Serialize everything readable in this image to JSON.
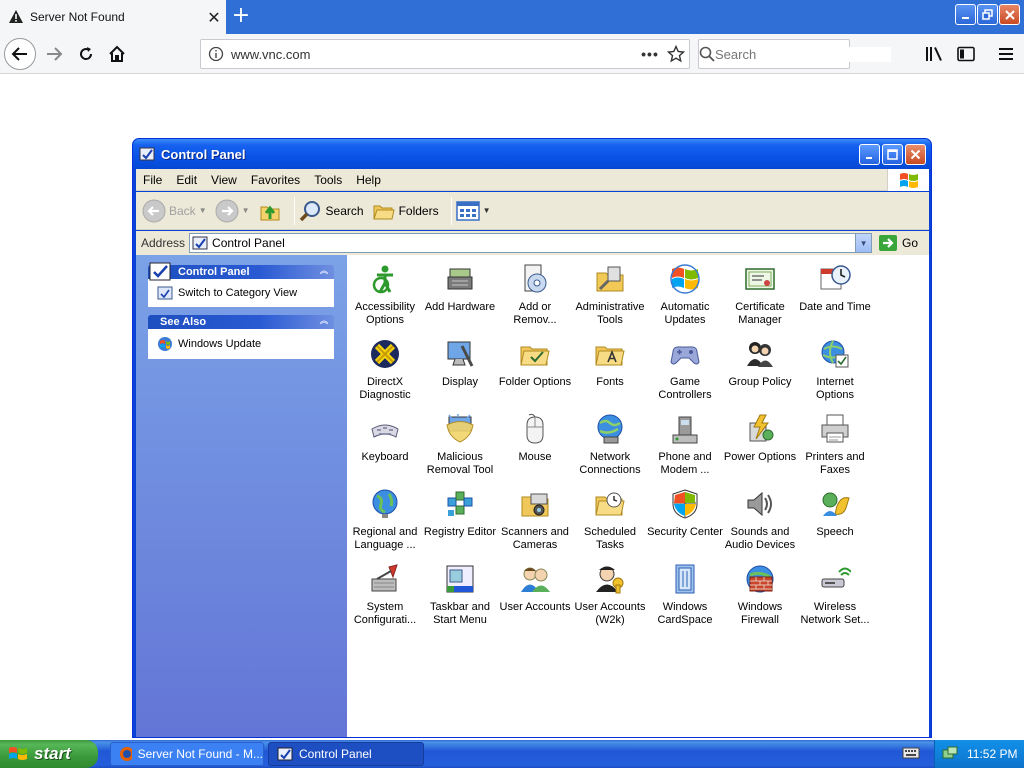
{
  "browser": {
    "tab_title": "Server Not Found",
    "url": "www.vnc.com",
    "search_placeholder": "Search",
    "page_actions": "•••"
  },
  "window": {
    "title": "Control Panel",
    "menu": [
      "File",
      "Edit",
      "View",
      "Favorites",
      "Tools",
      "Help"
    ],
    "toolbar": {
      "back": "Back",
      "search": "Search",
      "folders": "Folders"
    },
    "address": {
      "label": "Address",
      "value": "Control Panel",
      "go": "Go"
    }
  },
  "sidebar": {
    "control_panel_head": "Control Panel",
    "switch_view": "Switch to Category View",
    "see_also_head": "See Also",
    "windows_update": "Windows Update"
  },
  "items": [
    {
      "label": "Accessibility Options",
      "icon": "accessibility-icon"
    },
    {
      "label": "Add Hardware",
      "icon": "add-hardware-icon"
    },
    {
      "label": "Add or Remov...",
      "icon": "add-remove-icon"
    },
    {
      "label": "Administrative Tools",
      "icon": "admin-tools-icon"
    },
    {
      "label": "Automatic Updates",
      "icon": "automatic-updates-icon"
    },
    {
      "label": "Certificate Manager",
      "icon": "certificate-icon"
    },
    {
      "label": "Date and Time",
      "icon": "date-time-icon"
    },
    {
      "label": "DirectX Diagnostic",
      "icon": "directx-icon"
    },
    {
      "label": "Display",
      "icon": "display-icon"
    },
    {
      "label": "Folder Options",
      "icon": "folder-options-icon"
    },
    {
      "label": "Fonts",
      "icon": "fonts-icon"
    },
    {
      "label": "Game Controllers",
      "icon": "game-controller-icon"
    },
    {
      "label": "Group Policy",
      "icon": "group-policy-icon"
    },
    {
      "label": "Internet Options",
      "icon": "internet-options-icon"
    },
    {
      "label": "Keyboard",
      "icon": "keyboard-icon"
    },
    {
      "label": "Malicious Removal Tool",
      "icon": "malicious-removal-icon"
    },
    {
      "label": "Mouse",
      "icon": "mouse-icon"
    },
    {
      "label": "Network Connections",
      "icon": "network-icon"
    },
    {
      "label": "Phone and Modem ...",
      "icon": "phone-modem-icon"
    },
    {
      "label": "Power Options",
      "icon": "power-icon"
    },
    {
      "label": "Printers and Faxes",
      "icon": "printer-icon"
    },
    {
      "label": "Regional and Language ...",
      "icon": "regional-icon"
    },
    {
      "label": "Registry Editor",
      "icon": "registry-icon"
    },
    {
      "label": "Scanners and Cameras",
      "icon": "scanner-icon"
    },
    {
      "label": "Scheduled Tasks",
      "icon": "scheduled-tasks-icon"
    },
    {
      "label": "Security Center",
      "icon": "security-center-icon"
    },
    {
      "label": "Sounds and Audio Devices",
      "icon": "sound-icon"
    },
    {
      "label": "Speech",
      "icon": "speech-icon"
    },
    {
      "label": "System Configurati...",
      "icon": "system-config-icon"
    },
    {
      "label": "Taskbar and Start Menu",
      "icon": "taskbar-icon"
    },
    {
      "label": "User Accounts",
      "icon": "user-accounts-icon"
    },
    {
      "label": "User Accounts (W2k)",
      "icon": "user-accounts-w2k-icon"
    },
    {
      "label": "Windows CardSpace",
      "icon": "cardspace-icon"
    },
    {
      "label": "Windows Firewall",
      "icon": "firewall-icon"
    },
    {
      "label": "Wireless Network Set...",
      "icon": "wireless-icon"
    }
  ],
  "taskbar": {
    "start": "start",
    "tasks": [
      "Server Not Found - M...",
      "Control Panel"
    ],
    "clock": "11:52 PM"
  },
  "colors": {
    "xp_blue": "#0a52e6",
    "firefox_tabbar": "#2f6fd6",
    "start_green": "#3a9a3a",
    "sidebar_blue": "#7ba2e7"
  }
}
